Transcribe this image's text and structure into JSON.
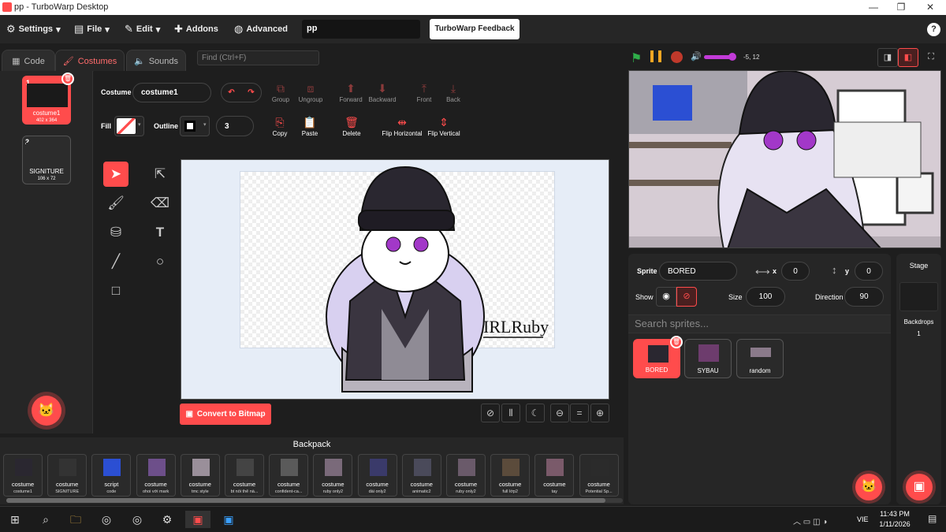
{
  "window": {
    "title": "pp - TurboWarp Desktop",
    "minimize": "—",
    "maximize": "❐",
    "close": "✕"
  },
  "menubar": {
    "settings": "Settings",
    "file": "File",
    "edit": "Edit",
    "addons": "Addons",
    "advanced": "Advanced",
    "project_title": "pp",
    "feedback": "TurboWarp Feedback",
    "help": "?"
  },
  "tabs": {
    "code": "Code",
    "costumes": "Costumes",
    "sounds": "Sounds",
    "find_placeholder": "Find (Ctrl+F)"
  },
  "costumes": [
    {
      "num": "1",
      "name": "costume1",
      "size": "402 x 364"
    },
    {
      "num": "2",
      "name": "SIGNITURE",
      "size": "106 x 72"
    }
  ],
  "paint": {
    "costume_label": "Costume",
    "costume_name": "costume1",
    "group": "Group",
    "ungroup": "Ungroup",
    "forward": "Forward",
    "backward": "Backward",
    "front": "Front",
    "back": "Back",
    "fill_label": "Fill",
    "outline_label": "Outline",
    "outline_width": "3",
    "copy": "Copy",
    "paste": "Paste",
    "delete": "Delete",
    "flip_h": "Flip Horizontal",
    "flip_v": "Flip Vertical",
    "convert": "Convert to Bitmap",
    "zoom_reset": "=",
    "signature_text": "IRLRuby"
  },
  "stage_header": {
    "coords": "-5, 12"
  },
  "sprite_info": {
    "sprite_label": "Sprite",
    "sprite_name": "BORED",
    "x_label": "x",
    "x": "0",
    "y_label": "y",
    "y": "0",
    "show_label": "Show",
    "size_label": "Size",
    "size": "100",
    "direction_label": "Direction",
    "direction": "90",
    "search_placeholder": "Search sprites..."
  },
  "sprites": [
    {
      "name": "BORED"
    },
    {
      "name": "SYBAU"
    },
    {
      "name": "random"
    }
  ],
  "stage_panel": {
    "title": "Stage",
    "backdrops_label": "Backdrops",
    "backdrops_count": "1"
  },
  "backpack": {
    "title": "Backpack",
    "items": [
      {
        "kind": "costume",
        "name": "costume1"
      },
      {
        "kind": "costume",
        "name": "SIGNITURE"
      },
      {
        "kind": "script",
        "name": "code"
      },
      {
        "kind": "costume",
        "name": "ohoi với mark"
      },
      {
        "kind": "costume",
        "name": "tmc style"
      },
      {
        "kind": "costume",
        "name": "bt nối thể nà..."
      },
      {
        "kind": "costume",
        "name": "confident-ca..."
      },
      {
        "kind": "costume",
        "name": "ruby only2"
      },
      {
        "kind": "costume",
        "name": "dài only2"
      },
      {
        "kind": "costume",
        "name": "animatic2"
      },
      {
        "kind": "costume",
        "name": "ruby only2"
      },
      {
        "kind": "costume",
        "name": "full lớp2"
      },
      {
        "kind": "costume",
        "name": "tay"
      },
      {
        "kind": "costume",
        "name": "Potential Sp..."
      }
    ]
  },
  "taskbar": {
    "lang": "VIE",
    "time": "11:43 PM",
    "date": "1/11/2026"
  },
  "colors": {
    "accent": "#ff4c4c",
    "bg": "#1e1e1e",
    "panel": "#262626",
    "volume": "#c23bd8",
    "flag": "#2fae4a",
    "pause": "#f5a623"
  }
}
